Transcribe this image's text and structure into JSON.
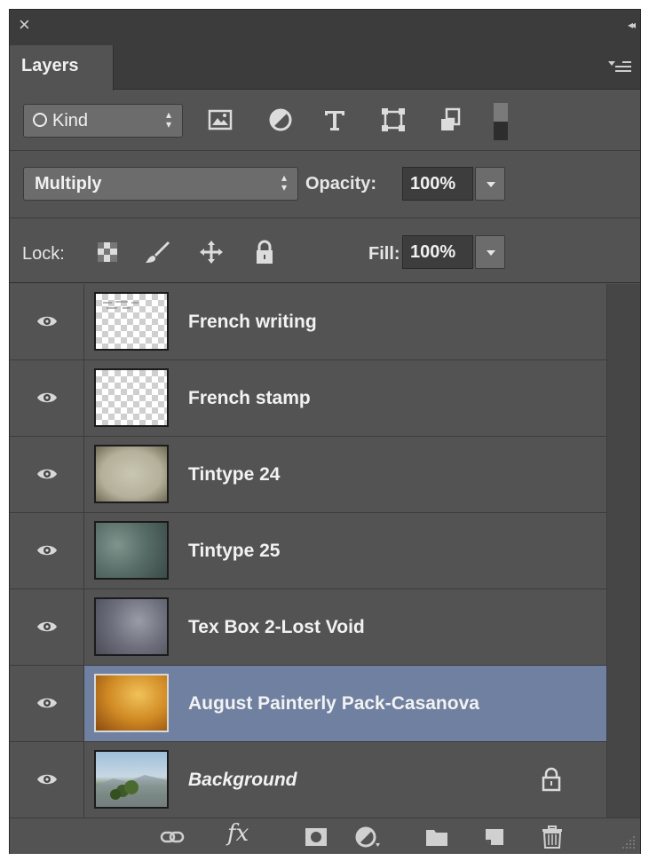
{
  "panel": {
    "close_glyph": "×",
    "collapse_glyph": "◂◂",
    "tab_label": "Layers"
  },
  "filter": {
    "kind_label": "Kind",
    "icons": [
      "pixel-layer-filter-icon",
      "adjustment-layer-filter-icon",
      "type-layer-filter-icon",
      "shape-layer-filter-icon",
      "smart-object-filter-icon",
      "filter-toggle-switch"
    ]
  },
  "blend": {
    "mode": "Multiply",
    "opacity_label": "Opacity:",
    "opacity_value": "100%"
  },
  "lock": {
    "label": "Lock:",
    "fill_label": "Fill:",
    "fill_value": "100%"
  },
  "layers": [
    {
      "name": "French writing",
      "thumb": "transparent-with-text",
      "visible": true,
      "selected": false
    },
    {
      "name": "French stamp",
      "thumb": "transparent",
      "visible": true,
      "selected": false
    },
    {
      "name": "Tintype 24",
      "thumb": "beige-texture",
      "visible": true,
      "selected": false
    },
    {
      "name": "Tintype 25",
      "thumb": "green-grey-texture",
      "visible": true,
      "selected": false
    },
    {
      "name": "Tex Box 2-Lost Void",
      "thumb": "grey-blue-texture",
      "visible": true,
      "selected": false
    },
    {
      "name": "August Painterly Pack-Casanova",
      "thumb": "golden-orange-texture",
      "visible": true,
      "selected": true
    },
    {
      "name": "Background",
      "thumb": "landscape-photo",
      "visible": true,
      "selected": false,
      "locked": true,
      "italic": true
    }
  ],
  "bottom_bar": {
    "fx_label": "fx",
    "icons": [
      "link-layers-icon",
      "fx-icon",
      "add-mask-icon",
      "adjustment-layer-icon",
      "new-group-folder-icon",
      "new-layer-icon",
      "trash-icon"
    ]
  },
  "colors": {
    "panel_bg": "#535353",
    "selected_row": "#6f80a0",
    "title_bar": "#3c3c3c"
  }
}
